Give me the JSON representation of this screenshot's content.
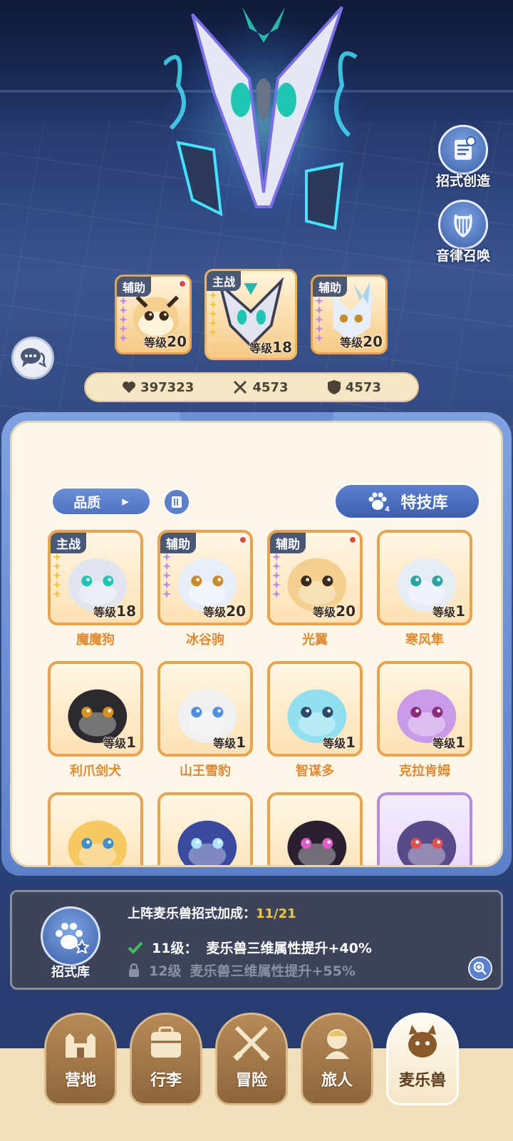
{
  "side_buttons": [
    {
      "label": "招式创造",
      "icon": "scroll-icon"
    },
    {
      "label": "音律召唤",
      "icon": "lyre-icon"
    }
  ],
  "team": [
    {
      "tag": "辅助",
      "level_text": "等级",
      "level": "20",
      "red_dot": true
    },
    {
      "tag": "主战",
      "level_text": "等级",
      "level": "18",
      "red_dot": false
    },
    {
      "tag": "辅助",
      "level_text": "等级",
      "level": "20",
      "red_dot": false
    }
  ],
  "stats": {
    "hp": "397323",
    "attack": "4573",
    "defense": "4573"
  },
  "filters": {
    "quality_label": "品质",
    "skill_library_label": "特技库"
  },
  "pets": [
    {
      "name": "魔魔狗",
      "tag": "主战",
      "level_text": "等级",
      "level": "18",
      "red_dot": false
    },
    {
      "name": "冰谷驹",
      "tag": "辅助",
      "level_text": "等级",
      "level": "20",
      "red_dot": true
    },
    {
      "name": "光翼",
      "tag": "辅助",
      "level_text": "等级",
      "level": "20",
      "red_dot": true
    },
    {
      "name": "寒风隼",
      "tag": "",
      "level_text": "等级",
      "level": "1",
      "red_dot": false
    },
    {
      "name": "利爪剑犬",
      "tag": "",
      "level_text": "等级",
      "level": "1",
      "red_dot": false
    },
    {
      "name": "山王雪豹",
      "tag": "",
      "level_text": "等级",
      "level": "1",
      "red_dot": false
    },
    {
      "name": "智谋多",
      "tag": "",
      "level_text": "等级",
      "level": "1",
      "red_dot": false
    },
    {
      "name": "克拉肯姆",
      "tag": "",
      "level_text": "等级",
      "level": "1",
      "red_dot": false
    },
    {
      "name": "",
      "tag": "",
      "level_text": "",
      "level": "",
      "red_dot": false
    },
    {
      "name": "",
      "tag": "",
      "level_text": "",
      "level": "",
      "red_dot": false
    },
    {
      "name": "",
      "tag": "",
      "level_text": "",
      "level": "",
      "red_dot": false
    },
    {
      "name": "",
      "tag": "",
      "level_text": "",
      "level": "",
      "red_dot": false
    }
  ],
  "bonus": {
    "icon_label": "招式库",
    "title": "上阵麦乐兽招式加成：",
    "count": "11/21",
    "lines": [
      {
        "level": "11级：",
        "text": "麦乐兽三维属性提升+40%",
        "unlocked": true
      },
      {
        "level": "12级",
        "text": "麦乐兽三维属性提升+55%",
        "unlocked": false
      }
    ]
  },
  "nav": [
    {
      "label": "营地",
      "icon": "castle-icon",
      "active": false
    },
    {
      "label": "行李",
      "icon": "bag-icon",
      "active": false
    },
    {
      "label": "冒险",
      "icon": "swords-icon",
      "active": false
    },
    {
      "label": "旅人",
      "icon": "traveler-icon",
      "active": false
    },
    {
      "label": "麦乐兽",
      "icon": "pet-icon",
      "active": true
    }
  ],
  "colors": {
    "accent_blue": "#5b7fd0",
    "card_orange": "#e8a34c",
    "name_orange": "#e0892e",
    "bonus_yellow": "#f3c547"
  }
}
